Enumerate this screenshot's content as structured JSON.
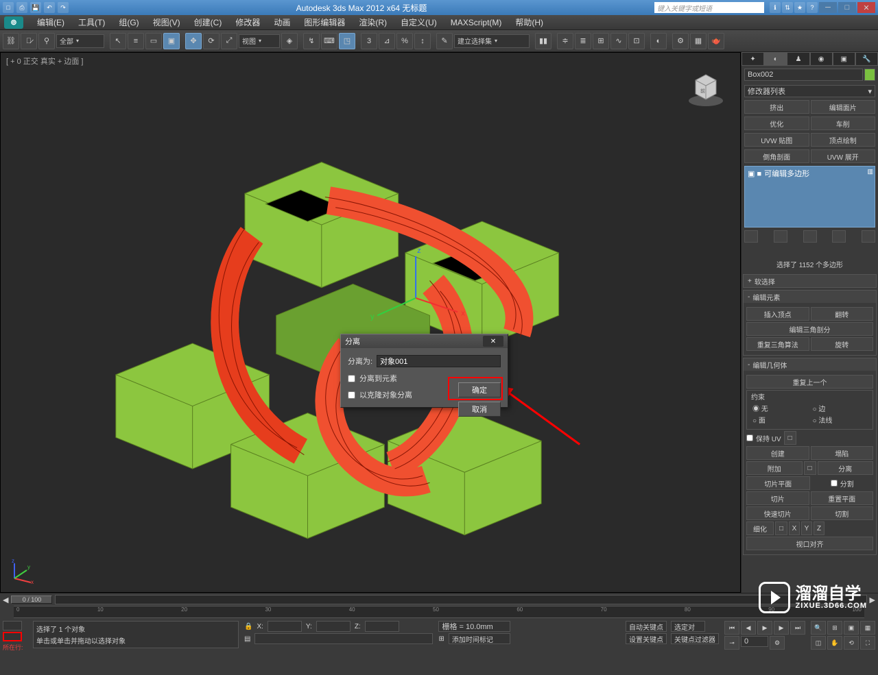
{
  "title": "Autodesk 3ds Max 2012 x64   无标题",
  "search_placeholder": "键入关键字或短语",
  "menu": [
    "编辑(E)",
    "工具(T)",
    "组(G)",
    "视图(V)",
    "创建(C)",
    "修改器",
    "动画",
    "图形编辑器",
    "渲染(R)",
    "自定义(U)",
    "MAXScript(M)",
    "帮助(H)"
  ],
  "toolbar": {
    "selection_filter": "全部",
    "view_select": "视图"
  },
  "ref_coord": "建立选择集",
  "viewport_label": "[ + 0 正交 真实 + 边面 ]",
  "time": {
    "slider": "0 / 100",
    "span": [
      "0",
      "10",
      "20",
      "30",
      "40",
      "50",
      "60",
      "70",
      "80",
      "90",
      "100"
    ]
  },
  "cmd": {
    "object_name": "Box002",
    "modifier_placeholder": "修改器列表",
    "mod_buttons": [
      [
        "挤出",
        "编辑面片"
      ],
      [
        "优化",
        "车削"
      ],
      [
        "UVW 贴图",
        "顶点绘制"
      ],
      [
        "倒角剖面",
        "UVW 展开"
      ]
    ],
    "stack_item": "可编辑多边形",
    "selection_info": "选择了 1152 个多边形",
    "rollouts": {
      "soft": "软选择",
      "edit_el": "编辑元素",
      "edit_el_btns": [
        [
          "插入顶点",
          "翻转"
        ]
      ],
      "edit_tri": "编辑三角剖分",
      "retri": [
        "重复三角算法",
        "旋转"
      ],
      "edit_geo": "编辑几何体",
      "repeat_last": "重复上一个",
      "constraints": "约束",
      "radios": [
        "无",
        "边",
        "面",
        "法线"
      ],
      "preserve_uv": "保持 UV",
      "create_collapse": [
        "创建",
        "塌陷"
      ],
      "attach_detach": [
        "附加",
        "分离"
      ],
      "slice_plane": [
        "切片平面",
        "分割"
      ],
      "slice_reset": [
        "切片",
        "重置平面"
      ],
      "quickslice_cut": [
        "快速切片",
        "切割"
      ],
      "msmooth": "细化",
      "xyz": [
        "X",
        "Y",
        "Z"
      ],
      "align": "视口对齐"
    }
  },
  "dialog": {
    "title": "分离",
    "label": "分离为:",
    "value": "对象001",
    "chk1": "分离到元素",
    "chk2": "以克隆对象分离",
    "ok": "确定",
    "cancel": "取消"
  },
  "status": {
    "nowline": "所在行:",
    "line1": "选择了 1 个对象",
    "line2": "单击或单击并拖动以选择对象",
    "grid": "栅格 = 10.0mm",
    "autokey": "自动关键点",
    "selkey": "选定对",
    "setkey": "设置关键点",
    "keyfilter": "关键点过滤器",
    "addmarker": "添加时间标记",
    "X": "X:",
    "Y": "Y:",
    "Z": "Z:"
  },
  "watermark": {
    "main": "溜溜自学",
    "sub": "ZIXUE.3D66.COM"
  }
}
